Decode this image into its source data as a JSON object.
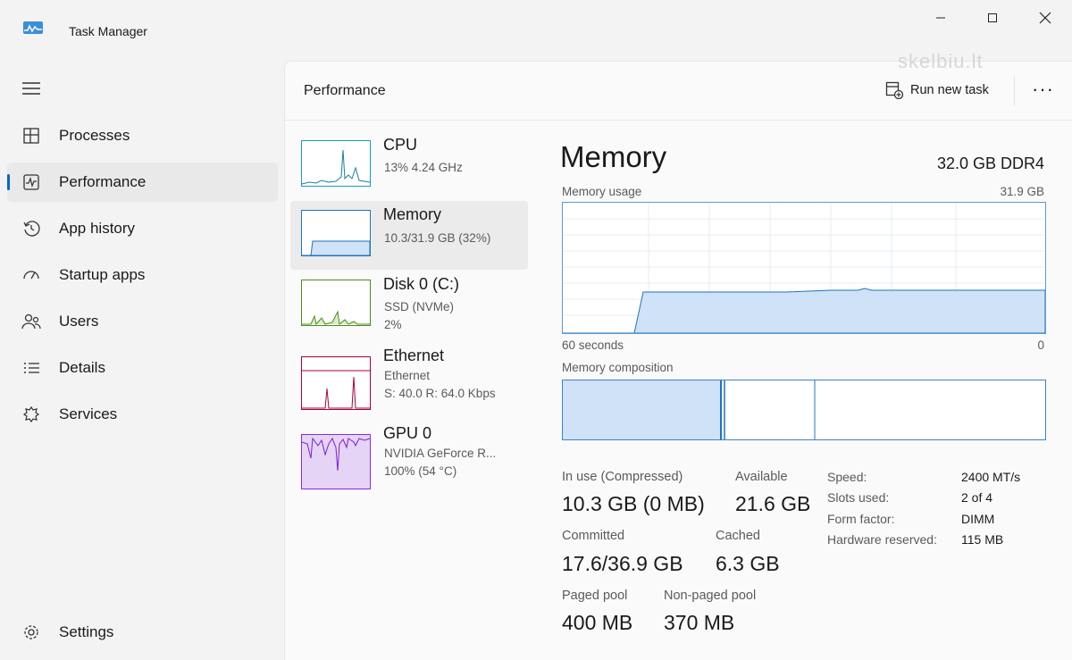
{
  "window": {
    "title": "Task Manager",
    "watermark": "skelbiu.lt",
    "colors": {
      "accent": "#0067c0",
      "memory": "#1e73be",
      "memory_fill": "#cfe2f7",
      "disk": "#4f8a1a",
      "ethernet": "#a8003c",
      "gpu": "#8a2be2"
    }
  },
  "sidebar": {
    "items": [
      {
        "label": "Processes",
        "icon": "processes-icon"
      },
      {
        "label": "Performance",
        "icon": "performance-icon",
        "active": true
      },
      {
        "label": "App history",
        "icon": "app-history-icon"
      },
      {
        "label": "Startup apps",
        "icon": "startup-apps-icon"
      },
      {
        "label": "Users",
        "icon": "users-icon"
      },
      {
        "label": "Details",
        "icon": "details-icon"
      },
      {
        "label": "Services",
        "icon": "services-icon"
      }
    ],
    "settings_label": "Settings"
  },
  "header": {
    "title": "Performance",
    "run_new_task": "Run new task",
    "more": "···"
  },
  "devices": [
    {
      "name": "CPU",
      "line1": "13% 4.24 GHz",
      "line2": ""
    },
    {
      "name": "Memory",
      "line1": "10.3/31.9 GB (32%)",
      "line2": "",
      "active": true
    },
    {
      "name": "Disk 0 (C:)",
      "line1": "SSD (NVMe)",
      "line2": "2%"
    },
    {
      "name": "Ethernet",
      "line1": "Ethernet",
      "line2": "S: 40.0 R: 64.0 Kbps"
    },
    {
      "name": "GPU 0",
      "line1": "NVIDIA GeForce R...",
      "line2": "100% (54 °C)"
    }
  ],
  "memory": {
    "title": "Memory",
    "spec": "32.0 GB DDR4",
    "usage_label": "Memory usage",
    "usage_max": "31.9 GB",
    "x_left": "60 seconds",
    "x_right": "0",
    "composition_label": "Memory composition",
    "usage_fraction": 0.32,
    "stats": {
      "in_use_label": "In use (Compressed)",
      "in_use_value": "10.3 GB (0 MB)",
      "available_label": "Available",
      "available_value": "21.6 GB",
      "committed_label": "Committed",
      "committed_value": "17.6/36.9 GB",
      "cached_label": "Cached",
      "cached_value": "6.3 GB",
      "paged_label": "Paged pool",
      "paged_value": "400 MB",
      "nonpaged_label": "Non-paged pool",
      "nonpaged_value": "370 MB"
    },
    "specs": [
      {
        "label": "Speed:",
        "value": "2400 MT/s"
      },
      {
        "label": "Slots used:",
        "value": "2 of 4"
      },
      {
        "label": "Form factor:",
        "value": "DIMM"
      },
      {
        "label": "Hardware reserved:",
        "value": "115 MB"
      }
    ]
  }
}
